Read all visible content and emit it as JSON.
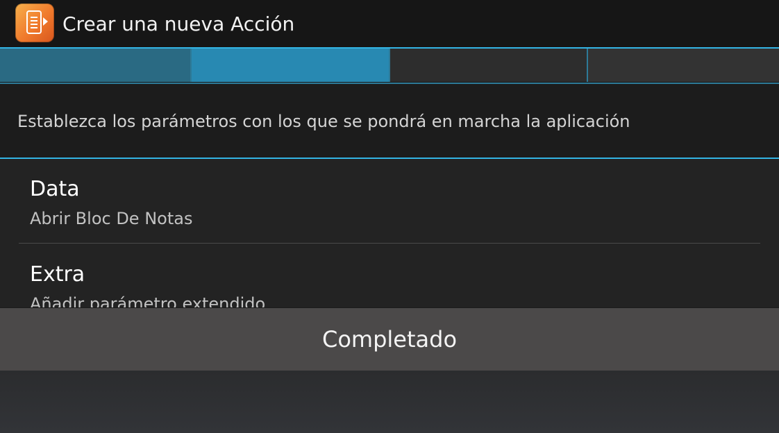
{
  "header": {
    "title": "Crear una nueva Acción",
    "app_icon": "app-icon",
    "accent_color": "#33b5e5"
  },
  "wizard": {
    "total_steps": 4,
    "current_step": 2
  },
  "instructions": "Establezca los parámetros con los que se pondrá en marcha la aplicación",
  "items": [
    {
      "title": "Data",
      "summary": "Abrir Bloc De Notas"
    },
    {
      "title": "Extra",
      "summary": "Añadir parámetro extendido"
    }
  ],
  "footer": {
    "done_label": "Completado"
  }
}
